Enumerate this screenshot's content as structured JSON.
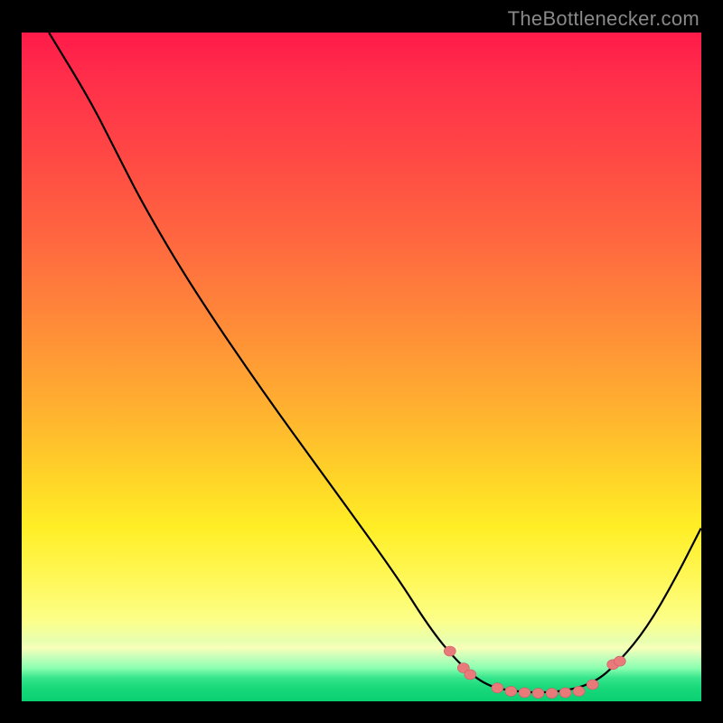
{
  "attribution": "TheBottlenecker.com",
  "chart_data": {
    "type": "line",
    "title": "",
    "xlabel": "",
    "ylabel": "",
    "x_range": [
      0,
      100
    ],
    "y_range": [
      0,
      100
    ],
    "curve": [
      {
        "x": 4,
        "y": 100
      },
      {
        "x": 10,
        "y": 90
      },
      {
        "x": 14,
        "y": 82
      },
      {
        "x": 18,
        "y": 74
      },
      {
        "x": 25,
        "y": 62
      },
      {
        "x": 35,
        "y": 47
      },
      {
        "x": 45,
        "y": 33
      },
      {
        "x": 55,
        "y": 19
      },
      {
        "x": 60,
        "y": 11
      },
      {
        "x": 64,
        "y": 6
      },
      {
        "x": 68,
        "y": 2.5
      },
      {
        "x": 72,
        "y": 1.5
      },
      {
        "x": 78,
        "y": 1.2
      },
      {
        "x": 84,
        "y": 2.5
      },
      {
        "x": 88,
        "y": 6
      },
      {
        "x": 92,
        "y": 11
      },
      {
        "x": 96,
        "y": 18
      },
      {
        "x": 100,
        "y": 26
      }
    ],
    "marker_points": [
      {
        "x": 63,
        "y": 7.5
      },
      {
        "x": 65,
        "y": 5
      },
      {
        "x": 66,
        "y": 4
      },
      {
        "x": 70,
        "y": 2
      },
      {
        "x": 72,
        "y": 1.5
      },
      {
        "x": 74,
        "y": 1.3
      },
      {
        "x": 76,
        "y": 1.2
      },
      {
        "x": 78,
        "y": 1.2
      },
      {
        "x": 80,
        "y": 1.3
      },
      {
        "x": 82,
        "y": 1.5
      },
      {
        "x": 84,
        "y": 2.5
      },
      {
        "x": 87,
        "y": 5.5
      },
      {
        "x": 88,
        "y": 6
      }
    ]
  }
}
